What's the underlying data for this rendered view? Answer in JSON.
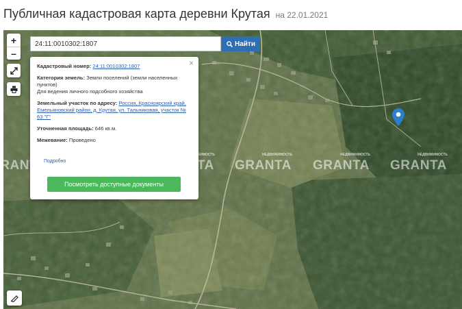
{
  "page": {
    "title": "Публичная кадастровая карта деревни Крутая",
    "date": "на 22.01.2021"
  },
  "search": {
    "value": "24:11:0010302:1807",
    "button_label": "Найти",
    "button_icon": "search-icon"
  },
  "controls": {
    "zoom_in": "+",
    "zoom_out": "–",
    "fullscreen_icon": "expand-icon",
    "print_icon": "print-icon",
    "measure_icon": "ruler-icon"
  },
  "popup": {
    "cadastral_label": "Кадастровый номер:",
    "cadastral_value": "24:11:0010302:1807",
    "category_label": "Категория земель:",
    "category_value": "Земли поселений (земли населенных пунктов)",
    "usage": "Для ведения личного подсобного хозяйства",
    "address_label": "Земельный участок по адресу:",
    "address_value": "Россия, Красноярский край, Емельяновский район, д. Крутая, ул. Тальниковая, участок № 63 \"Г\"",
    "area_label": "Уточненная площадь:",
    "area_value": "646 кв.м.",
    "survey_label": "Межевание:",
    "survey_value": "Проведено",
    "more_link": "Подробно",
    "docs_button": "Посмотреть доступные документы",
    "close": "×"
  },
  "watermark": {
    "text": "GRANTA",
    "sub": "НЕДВИЖИМОСТЬ"
  },
  "colors": {
    "map_base": "#5e7048",
    "search_button": "#2e6fb4",
    "docs_button": "#4cb85c",
    "marker": "#2a81cb"
  }
}
